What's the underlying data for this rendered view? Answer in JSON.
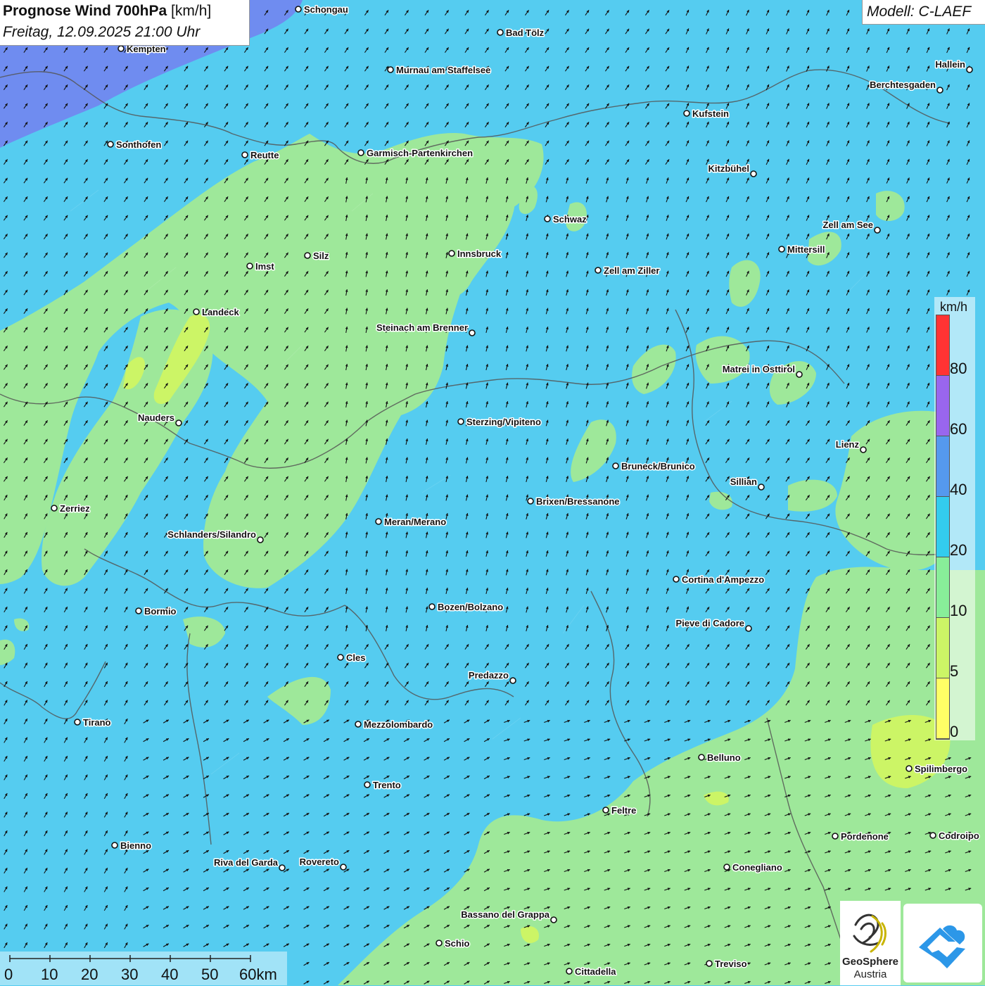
{
  "header": {
    "title": "Prognose Wind 700hPa",
    "unit": "[km/h]",
    "datetime": "Freitag, 12.09.2025 21:00 Uhr",
    "model": "Modell: C-LAEF"
  },
  "legend": {
    "unit": "km/h",
    "stops": [
      {
        "label": "80",
        "color": "#ff3333"
      },
      {
        "label": "60",
        "color": "#9966ee"
      },
      {
        "label": "40",
        "color": "#5599ee"
      },
      {
        "label": "20",
        "color": "#33ccee"
      },
      {
        "label": "10",
        "color": "#88ee99"
      },
      {
        "label": "5",
        "color": "#ccf566"
      },
      {
        "label": "0",
        "color": "#ffff66"
      }
    ]
  },
  "scale": {
    "labels": [
      "0",
      "10",
      "20",
      "30",
      "40",
      "50",
      "60km"
    ]
  },
  "colors": {
    "band_0_5": "#ffff66",
    "band_5_10": "#ccf566",
    "band_10_20": "#9ee89a",
    "band_20_40": "#55ccf0",
    "band_40_60": "#6f8cf0",
    "border": "#555555",
    "arrow": "#111111"
  },
  "cities": [
    {
      "name": "Schongau"
    },
    {
      "name": "Bad Tölz"
    },
    {
      "name": "Kempten"
    },
    {
      "name": "Murnau am Staffelsee"
    },
    {
      "name": "Hallein"
    },
    {
      "name": "Berchtesgaden"
    },
    {
      "name": "Kufstein"
    },
    {
      "name": "Sonthofen"
    },
    {
      "name": "Reutte"
    },
    {
      "name": "Garmisch-Partenkirchen"
    },
    {
      "name": "Kitzbühel"
    },
    {
      "name": "Schwaz"
    },
    {
      "name": "Zell am See"
    },
    {
      "name": "Mittersill"
    },
    {
      "name": "Innsbruck"
    },
    {
      "name": "Silz"
    },
    {
      "name": "Imst"
    },
    {
      "name": "Zell am Ziller"
    },
    {
      "name": "Landeck"
    },
    {
      "name": "Steinach am Brenner"
    },
    {
      "name": "Matrei in Osttirol"
    },
    {
      "name": "Nauders"
    },
    {
      "name": "Sterzing/Vipiteno"
    },
    {
      "name": "Lienz"
    },
    {
      "name": "Bruneck/Brunico"
    },
    {
      "name": "Sillian"
    },
    {
      "name": "Zerriez"
    },
    {
      "name": "Brixen/Bressanone"
    },
    {
      "name": "Meran/Merano"
    },
    {
      "name": "Schlanders/Silandro"
    },
    {
      "name": "Cortina d'Ampezzo"
    },
    {
      "name": "Bozen/Bolzano"
    },
    {
      "name": "Bormio"
    },
    {
      "name": "Pieve di Cadore"
    },
    {
      "name": "Cles"
    },
    {
      "name": "Predazzo"
    },
    {
      "name": "Tirano"
    },
    {
      "name": "Mezzolombardo"
    },
    {
      "name": "Belluno"
    },
    {
      "name": "Spilimbergo"
    },
    {
      "name": "Trento"
    },
    {
      "name": "Feltre"
    },
    {
      "name": "Bienno"
    },
    {
      "name": "Pordenone"
    },
    {
      "name": "Codroipo"
    },
    {
      "name": "Riva del Garda"
    },
    {
      "name": "Rovereto"
    },
    {
      "name": "Conegliano"
    },
    {
      "name": "Bassano del Grappa"
    },
    {
      "name": "Schio"
    },
    {
      "name": "Treviso"
    },
    {
      "name": "Cittadella"
    }
  ],
  "logos": {
    "geosphere_line1": "GeoSphere",
    "geosphere_line2": "Austria"
  }
}
